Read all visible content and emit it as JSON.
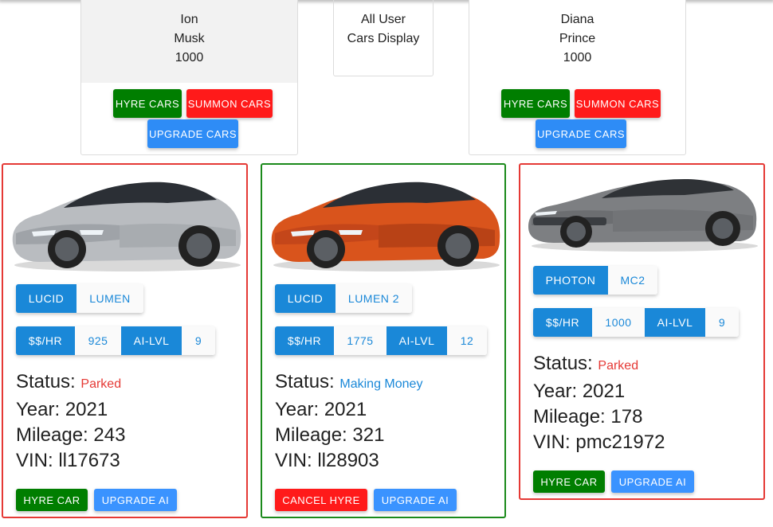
{
  "users": [
    {
      "first": "Ion",
      "last": "Musk",
      "balance": "1000",
      "buttons": {
        "hyre": "HYRE CARS",
        "summon": "SUMMON CARS",
        "upgrade": "UPGRADE CARS"
      }
    },
    {
      "first": "Diana",
      "last": "Prince",
      "balance": "1000",
      "buttons": {
        "hyre": "HYRE CARS",
        "summon": "SUMMON CARS",
        "upgrade": "UPGRADE CARS"
      }
    }
  ],
  "display": {
    "line1": "All User",
    "line2": "Cars Display"
  },
  "cars": [
    {
      "make": "LUCID",
      "model": "LUMEN",
      "rate_label": "$$/HR",
      "rate": "925",
      "ai_label": "AI-LVL",
      "ai": "9",
      "status_label": "Status:",
      "status": "Parked",
      "year": "Year: 2021",
      "mileage": "Mileage: 243",
      "vin": "VIN: ll17673",
      "action1": "HYRE CAR",
      "action2": "UPGRADE AI",
      "border": "#e53935",
      "color": "silver"
    },
    {
      "make": "LUCID",
      "model": "LUMEN 2",
      "rate_label": "$$/HR",
      "rate": "1775",
      "ai_label": "AI-LVL",
      "ai": "12",
      "status_label": "Status:",
      "status": "Making Money",
      "year": "Year: 2021",
      "mileage": "Mileage: 321",
      "vin": "VIN: ll28903",
      "action1": "CANCEL HYRE",
      "action2": "UPGRADE AI",
      "border": "#1b8a1b",
      "color": "orange"
    },
    {
      "make": "PHOTON",
      "model": "MC2",
      "rate_label": "$$/HR",
      "rate": "1000",
      "ai_label": "AI-LVL",
      "ai": "9",
      "status_label": "Status:",
      "status": "Parked",
      "year": "Year: 2021",
      "mileage": "Mileage: 178",
      "vin": "VIN: pmc21972",
      "action1": "HYRE CAR",
      "action2": "UPGRADE AI",
      "border": "#e53935",
      "color": "grey"
    }
  ]
}
